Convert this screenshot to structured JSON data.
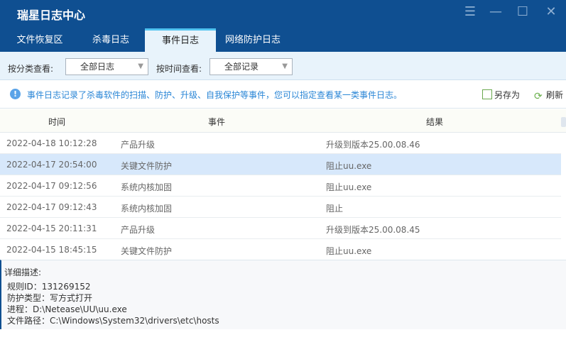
{
  "window": {
    "title": "瑞星日志中心",
    "icons": [
      "menu-icon",
      "minimize-icon",
      "maximize-icon",
      "close-icon"
    ]
  },
  "tabs": [
    {
      "label": "文件恢复区"
    },
    {
      "label": "杀毒日志"
    },
    {
      "label": "事件日志",
      "active": true
    },
    {
      "label": "网络防护日志"
    }
  ],
  "filters": {
    "category_label": "按分类查看:",
    "category_value": "全部日志",
    "time_label": "按时间查看:",
    "time_value": "全部记录"
  },
  "info": {
    "text": "事件日志记录了杀毒软件的扫描、防护、升级、自我保护等事件，您可以指定查看某一类事件日志。",
    "save_as": "另存为",
    "refresh": "刷新"
  },
  "table": {
    "headers": [
      "时间",
      "事件",
      "结果"
    ],
    "rows": [
      {
        "time": "2022-04-18 10:12:28",
        "event": "产品升级",
        "result": "升级到版本25.00.08.46"
      },
      {
        "time": "2022-04-17 20:54:00",
        "event": "关键文件防护",
        "result": "阻止uu.exe",
        "selected": true
      },
      {
        "time": "2022-04-17 09:12:56",
        "event": "系统内核加固",
        "result": "阻止uu.exe"
      },
      {
        "time": "2022-04-17 09:12:43",
        "event": "系统内核加固",
        "result": "阻止"
      },
      {
        "time": "2022-04-15 20:11:31",
        "event": "产品升级",
        "result": "升级到版本25.00.08.45"
      },
      {
        "time": "2022-04-15 18:45:15",
        "event": "关键文件防护",
        "result": "阻止uu.exe"
      }
    ]
  },
  "detail": {
    "label": "详细描述:",
    "lines": [
      "规则ID：131269152",
      "防护类型：写方式打开",
      "进程：D:\\Netease\\UU\\uu.exe",
      "文件路径：C:\\Windows\\System32\\drivers\\etc\\hosts"
    ]
  },
  "colors": {
    "titlebar": "#0f4f91",
    "tab_accent": "#4fc3f0",
    "info_text": "#2a86d6",
    "selected_row": "#d7e8fb"
  }
}
